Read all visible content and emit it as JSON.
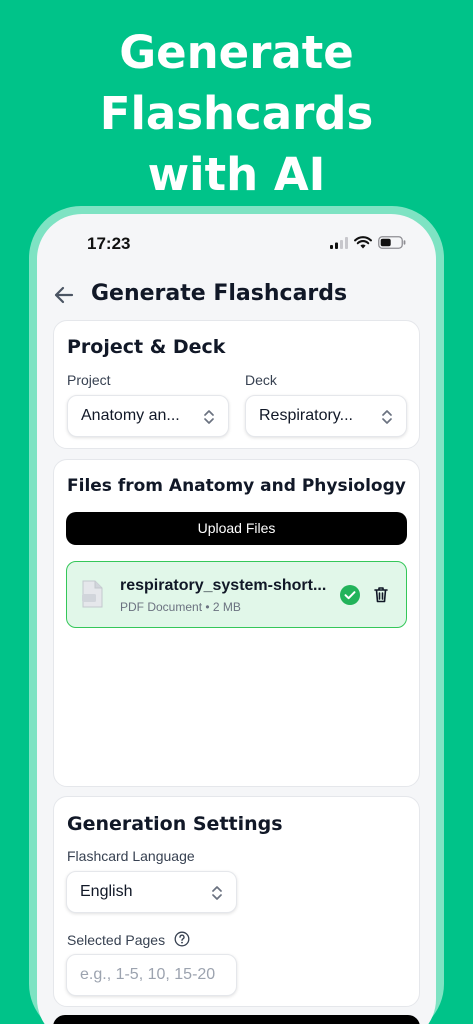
{
  "hero": {
    "line1": "Generate",
    "line2": "Flashcards",
    "line3": "with AI"
  },
  "status_bar": {
    "time": "17:23",
    "icons": [
      "cellular-signal-icon",
      "wifi-icon",
      "battery-icon"
    ]
  },
  "nav": {
    "back_icon": "arrow-left-icon",
    "title": "Generate Flashcards"
  },
  "project_deck": {
    "title": "Project & Deck",
    "project_label": "Project",
    "project_value": "Anatomy an...",
    "deck_label": "Deck",
    "deck_value": "Respiratory..."
  },
  "files": {
    "title": "Files from Anatomy and Physiology",
    "upload_label": "Upload Files",
    "items": [
      {
        "name": "respiratory_system-short...",
        "meta": "PDF Document • 2 MB",
        "status": "uploaded"
      }
    ]
  },
  "generation_settings": {
    "title": "Generation Settings",
    "language_label": "Flashcard Language",
    "language_value": "English",
    "pages_label": "Selected Pages",
    "pages_value": "",
    "pages_placeholder": "e.g., 1-5, 10, 15-20"
  },
  "colors": {
    "background": "#00C389",
    "success": "#34C759",
    "file_bg": "#E1F7E9",
    "primary_button": "#000000"
  }
}
